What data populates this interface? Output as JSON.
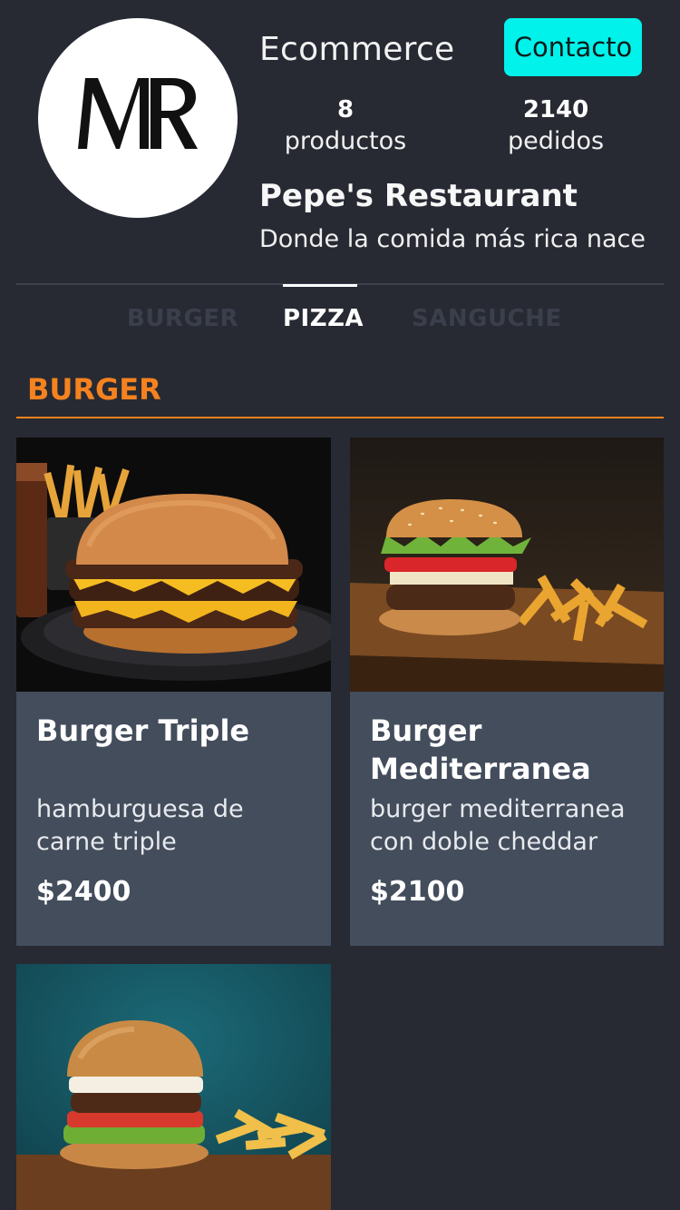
{
  "header": {
    "logo_text": "MR",
    "store_label": "Ecommerce",
    "contact_label": "Contacto",
    "stats": {
      "products_count": "8",
      "products_label": "productos",
      "orders_count": "2140",
      "orders_label": "pedidos"
    },
    "store_name": "Pepe's Restaurant",
    "tagline": "Donde la comida más rica nace"
  },
  "tabs": [
    {
      "label": "BURGER",
      "active": false
    },
    {
      "label": "PIZZA",
      "active": true
    },
    {
      "label": "SANGUCHE",
      "active": false
    }
  ],
  "section": {
    "title": "BURGER"
  },
  "products": [
    {
      "name": "Burger Triple",
      "description": "hamburguesa de carne triple",
      "price": "$2400",
      "image": "triple-cheeseburger-photo"
    },
    {
      "name": "Burger Mediterranea",
      "description": "burger mediterranea con doble cheddar",
      "price": "$2100",
      "image": "mediterranean-burger-with-fries-photo"
    },
    {
      "name": "",
      "description": "",
      "price": "",
      "image": "burger-with-fries-teal-background-photo"
    }
  ],
  "colors": {
    "background": "#272a33",
    "accent_cyan": "#00f2ea",
    "accent_orange": "#f5821f",
    "card_background": "#434d5c"
  }
}
